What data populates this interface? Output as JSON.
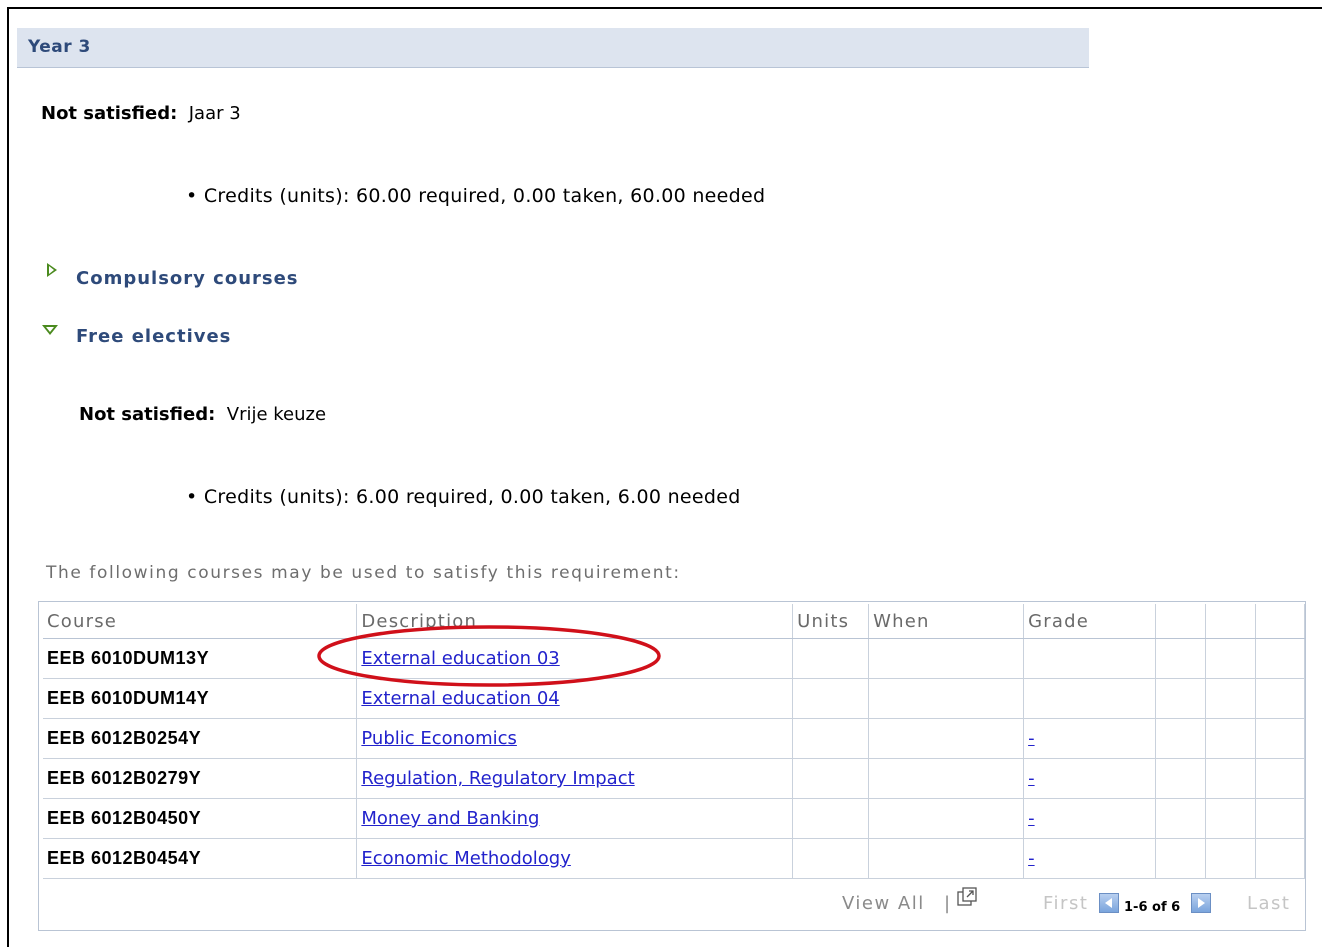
{
  "header": {
    "title": "Year 3"
  },
  "requirement": {
    "status_label": "Not satisfied:",
    "name": "Jaar 3",
    "credits_line": "Credits (units): 60.00 required, 0.00 taken, 60.00 needed"
  },
  "sections": {
    "compulsory": {
      "label": "Compulsory courses",
      "expanded": false
    },
    "electives": {
      "label": "Free electives",
      "expanded": true
    }
  },
  "electives": {
    "status_label": "Not satisfied:",
    "name": "Vrije keuze",
    "credits_line": "Credits (units): 6.00 required, 0.00 taken, 6.00 needed",
    "hint": "The following courses may be used to satisfy this requirement:"
  },
  "grid": {
    "columns": {
      "course": "Course",
      "description": "Description",
      "units": "Units",
      "when": "When",
      "grade": "Grade"
    },
    "rows": [
      {
        "course": "EEB 6010DUM13Y",
        "description": "External education 03",
        "grade": ""
      },
      {
        "course": "EEB 6010DUM14Y",
        "description": "External education 04",
        "grade": ""
      },
      {
        "course": "EEB 6012B0254Y",
        "description": "Public Economics",
        "grade": "-"
      },
      {
        "course": "EEB 6012B0279Y",
        "description": "Regulation, Regulatory Impact",
        "grade": "-"
      },
      {
        "course": "EEB 6012B0450Y",
        "description": "Money and Banking",
        "grade": "-"
      },
      {
        "course": "EEB 6012B0454Y",
        "description": "Economic Methodology",
        "grade": "-"
      }
    ],
    "footer": {
      "view_all": "View All",
      "separator": "|",
      "first": "First",
      "range": "1-6 of 6",
      "last": "Last"
    }
  },
  "colors": {
    "header_bg": "#dde4ef",
    "section_text": "#2e4a7a",
    "link": "#2222cc",
    "toggle_icon": "#4a8a1e",
    "annotation": "#d0101a"
  },
  "icons": {
    "collapsed": "triangle-right-icon",
    "expanded": "triangle-down-icon",
    "popout": "popout-window-icon",
    "prev": "arrow-left-icon",
    "next": "arrow-right-icon"
  }
}
